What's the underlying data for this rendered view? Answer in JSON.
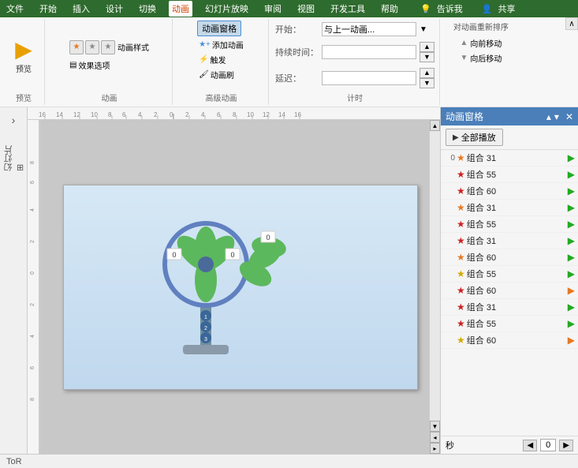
{
  "menubar": {
    "items": [
      "文件",
      "开始",
      "插入",
      "设计",
      "切换",
      "动画",
      "幻灯片放映",
      "审阅",
      "视图",
      "开发工具",
      "帮助",
      "告诉我",
      "共享"
    ],
    "active": "动画"
  },
  "toolbar": {
    "preview_label": "预览",
    "preview_group": "预览",
    "anim_style_label": "动画样式",
    "effect_options_label": "效果选项",
    "add_anim_label": "添加动画",
    "anim_brush_label": "动画刷",
    "trigger_label": "触发",
    "advanced_group": "高级动画",
    "anim_window_label": "动画窗格",
    "start_label": "开始：",
    "start_value": "与上一动画...",
    "duration_label": "持续时间：",
    "delay_label": "延迟：",
    "timing_group": "计时",
    "reorder_label": "对动画重新排序",
    "forward_label": "向前移动",
    "backward_label": "向后移动"
  },
  "anim_panel": {
    "title": "动画窗格",
    "play_all_label": "全部播放",
    "items": [
      {
        "num": "0",
        "star_type": "orange",
        "name": "组合 31",
        "play_type": "green"
      },
      {
        "num": "",
        "star_type": "red",
        "name": "组合 55",
        "play_type": "green"
      },
      {
        "num": "",
        "star_type": "red",
        "name": "组合 60",
        "play_type": "green"
      },
      {
        "num": "",
        "star_type": "orange",
        "name": "组合 31",
        "play_type": "green"
      },
      {
        "num": "",
        "star_type": "red",
        "name": "组合 55",
        "play_type": "green"
      },
      {
        "num": "",
        "star_type": "red",
        "name": "组合 31",
        "play_type": "green"
      },
      {
        "num": "",
        "star_type": "orange",
        "name": "组合 60",
        "play_type": "green"
      },
      {
        "num": "",
        "star_type": "gold",
        "name": "组合 55",
        "play_type": "green"
      },
      {
        "num": "",
        "star_type": "red",
        "name": "组合 60",
        "play_type": "orange"
      },
      {
        "num": "",
        "star_type": "red",
        "name": "组合 31",
        "play_type": "green"
      },
      {
        "num": "",
        "star_type": "red",
        "name": "组合 55",
        "play_type": "green"
      },
      {
        "num": "",
        "star_type": "gold",
        "name": "组合 60",
        "play_type": "orange"
      }
    ],
    "footer_label": "秒",
    "page_value": "0"
  },
  "status": {
    "slide_info": "ToR"
  },
  "ruler": {
    "marks": [
      "-16",
      "-14",
      "-12",
      "-10",
      "-8",
      "-6",
      "-4",
      "-2",
      "0",
      "2",
      "4",
      "6",
      "8",
      "10",
      "12",
      "14",
      "16"
    ]
  }
}
